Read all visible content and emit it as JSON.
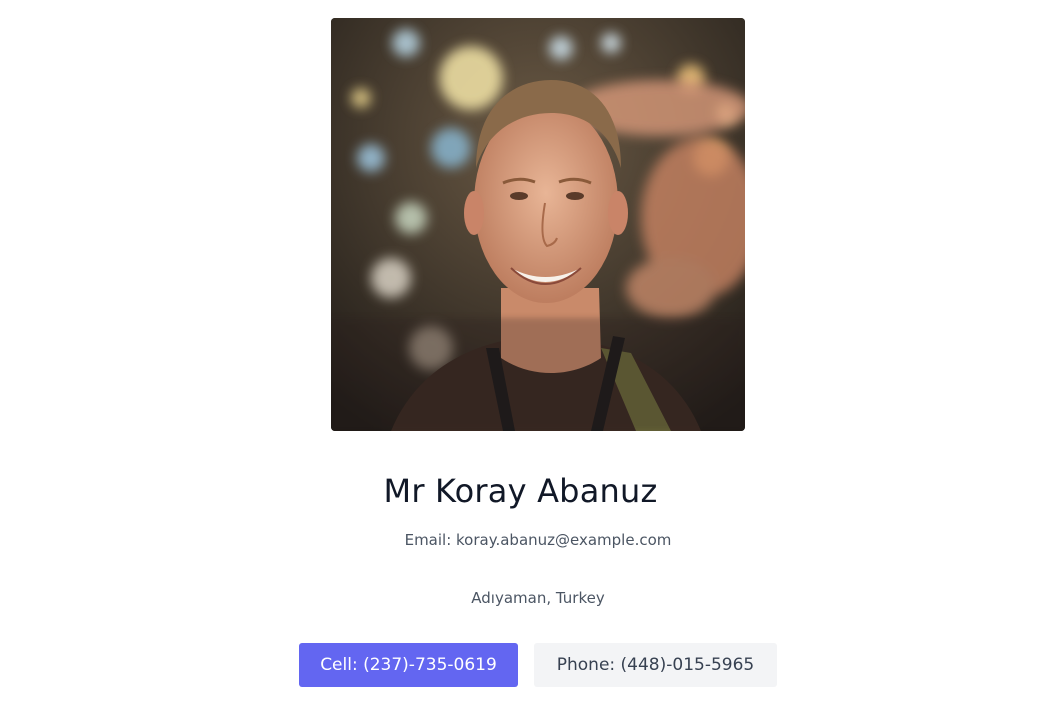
{
  "profile": {
    "name": "Mr Koray Abanuz",
    "email_line": "Email: koray.abanuz@example.com",
    "location": "Adıyaman, Turkey"
  },
  "actions": {
    "cell_label": "Cell: (237)-735-0619",
    "phone_label": "Phone: (448)-015-5965"
  },
  "colors": {
    "primary": "#6366f1",
    "secondary_bg": "#f3f4f6",
    "heading": "#111827",
    "text": "#4b5563"
  }
}
